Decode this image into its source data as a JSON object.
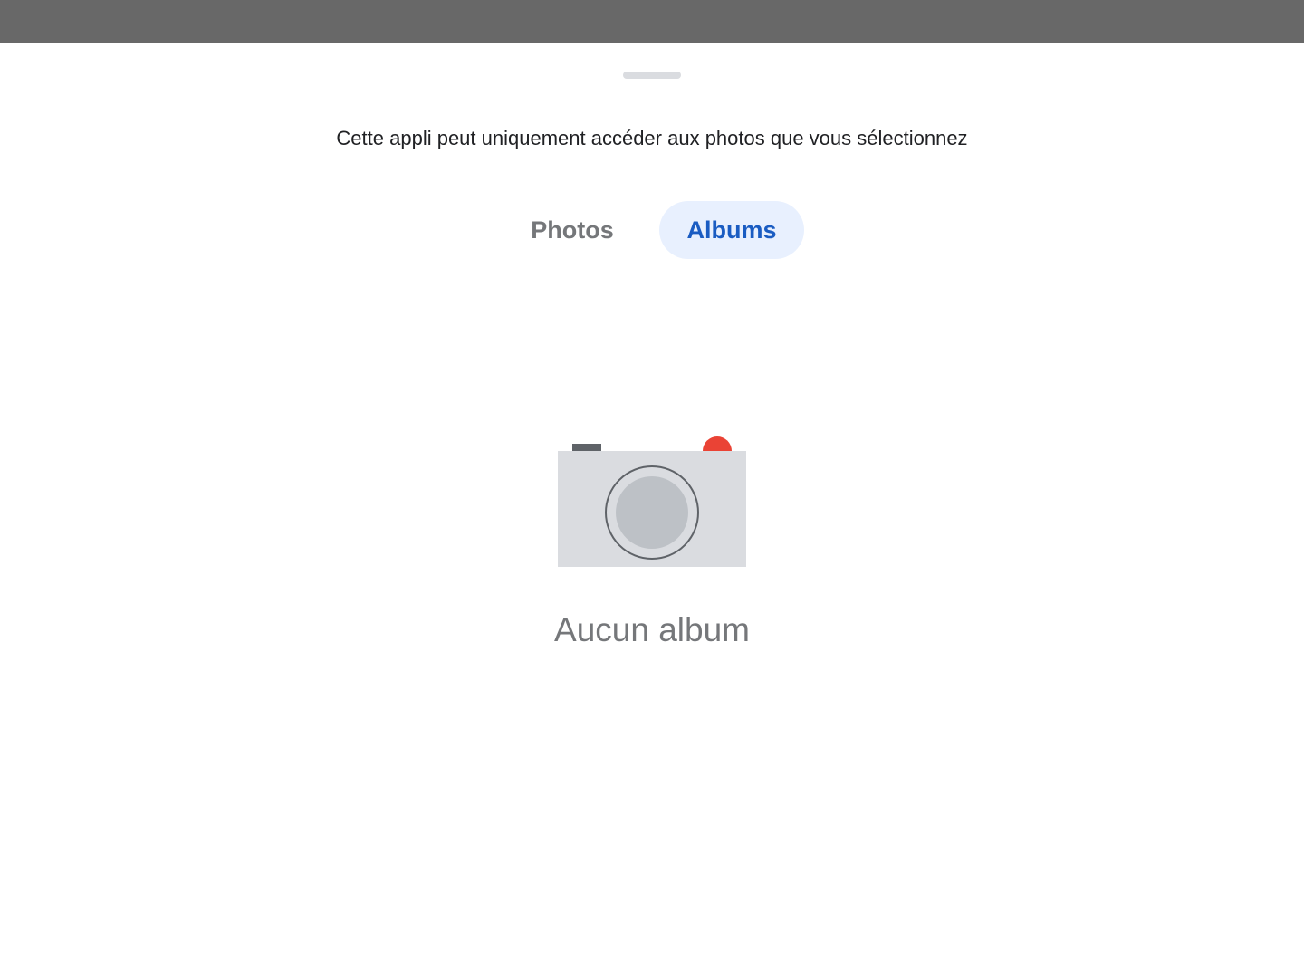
{
  "header": {
    "subtitle": "Cette appli peut uniquement accéder aux photos que vous sélectionnez"
  },
  "tabs": [
    {
      "label": "Photos",
      "selected": false
    },
    {
      "label": "Albums",
      "selected": true
    }
  ],
  "empty_state": {
    "icon": "camera-icon",
    "label": "Aucun album"
  },
  "colors": {
    "scrim": "#686868",
    "accent": "#1a5cc2",
    "selected_tab_bg": "#e8f0fe",
    "camera_flash": "#ea4335"
  }
}
